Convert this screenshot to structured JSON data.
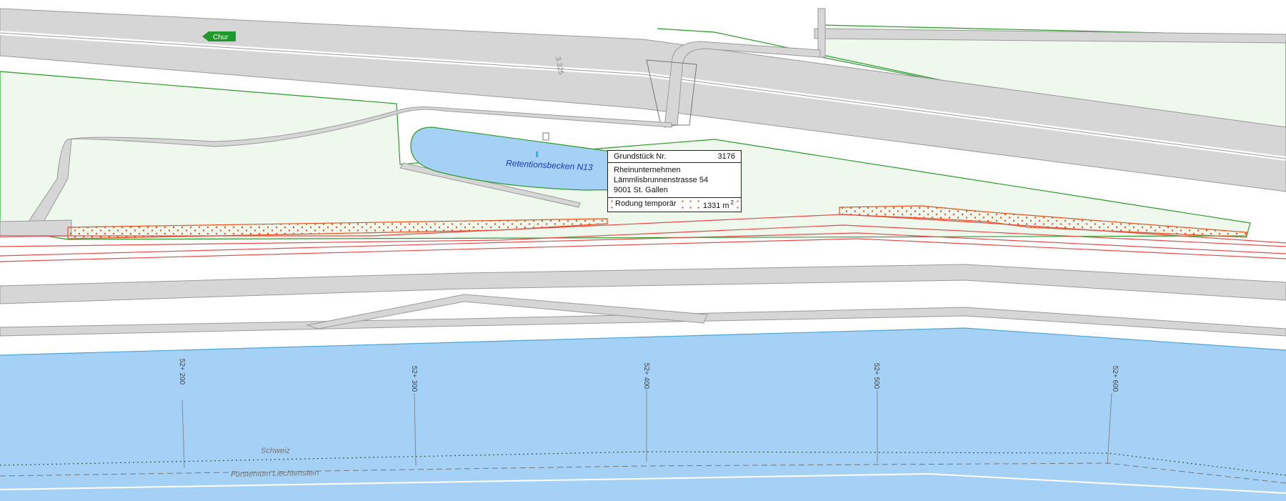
{
  "map": {
    "labels": {
      "direction_sign": "Chur",
      "road_number": "3.325",
      "basin_name": "Retentionsbecken N13",
      "country_north": "Schweiz",
      "country_south": "Fürstentum Liechtenstein"
    },
    "chainage_labels": [
      "52+ 200",
      "52+ 300",
      "52+ 400",
      "52+ 500",
      "52+ 600"
    ],
    "colors": {
      "water": "#a6d1f7",
      "road": "#d6d6d6",
      "parcel_outline": "#2e9a2e",
      "parcel_fill": "#eef8ec",
      "clearing_outline": "#e8501c",
      "rail_red": "#e84a4a",
      "sign_green": "#1f9a2a"
    }
  },
  "parcel_info": {
    "parcel_label": "Grundstück Nr.",
    "parcel_number": "3176",
    "owner_name": "Rheinunternehmen",
    "owner_street": "Lämmlisbrunnenstrasse 54",
    "owner_city": "9001 St. Gallen",
    "clearing_label": "Rodung temporär",
    "clearing_area": "1331 m",
    "clearing_area_unit_sup": "2"
  }
}
